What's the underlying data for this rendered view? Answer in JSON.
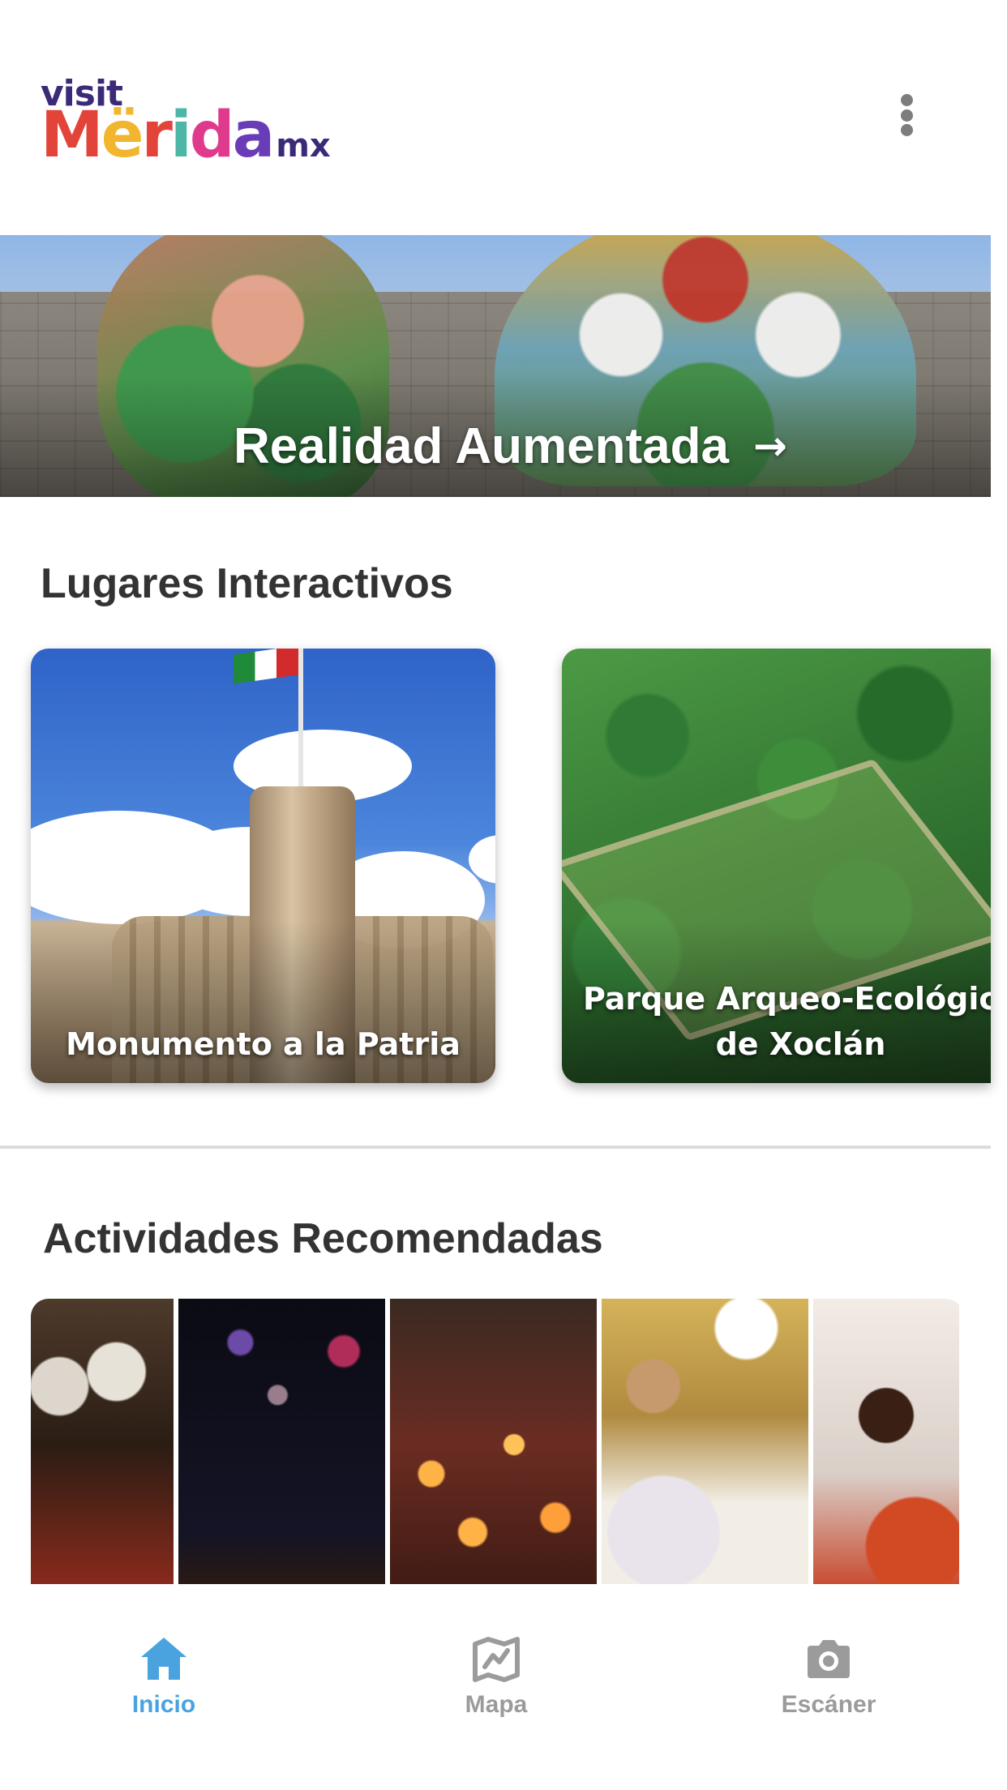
{
  "header": {
    "logo": {
      "top": "visit",
      "letters": [
        "M",
        "ë",
        "r",
        "i",
        "d",
        "a"
      ],
      "suffix": "mx"
    },
    "menu_icon": "more-vertical-icon"
  },
  "banner": {
    "label": "Realidad Aumentada",
    "arrow": "→"
  },
  "places": {
    "title": "Lugares Interactivos",
    "cards": [
      {
        "caption": "Monumento a la Patria"
      },
      {
        "caption": "Parque Arqueo-Ecológico de Xoclán"
      }
    ]
  },
  "activities": {
    "title": "Actividades Recomendadas"
  },
  "nav": {
    "items": [
      {
        "label": "Inicio",
        "icon": "home-icon",
        "active": true
      },
      {
        "label": "Mapa",
        "icon": "map-icon",
        "active": false
      },
      {
        "label": "Escáner",
        "icon": "camera-icon",
        "active": false
      }
    ]
  },
  "colors": {
    "accent": "#4aa3df",
    "inactive": "#9b9b9b",
    "heading": "#333333",
    "logo_letters": [
      "#e2443a",
      "#f2b52e",
      "#e2443a",
      "#4db6a6",
      "#e03a8c",
      "#6a3db8"
    ],
    "logo_navy": "#3b2a78"
  }
}
